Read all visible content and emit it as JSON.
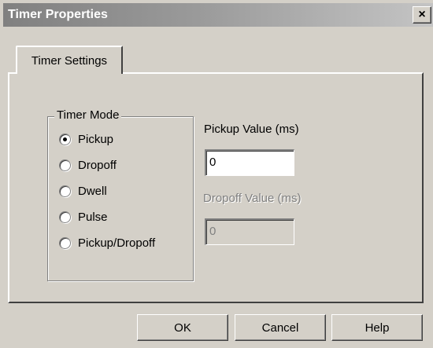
{
  "window": {
    "title": "Timer Properties",
    "close_label": "×"
  },
  "tabs": [
    {
      "label": "Timer Settings"
    }
  ],
  "timer_mode": {
    "title": "Timer Mode",
    "options": [
      {
        "label": "Pickup",
        "selected": true
      },
      {
        "label": "Dropoff",
        "selected": false
      },
      {
        "label": "Dwell",
        "selected": false
      },
      {
        "label": "Pulse",
        "selected": false
      },
      {
        "label": "Pickup/Dropoff",
        "selected": false
      }
    ]
  },
  "pickup": {
    "label": "Pickup Value (ms)",
    "value": "0",
    "enabled": true
  },
  "dropoff": {
    "label": "Dropoff Value (ms)",
    "value": "0",
    "enabled": false
  },
  "buttons": {
    "ok": "OK",
    "cancel": "Cancel",
    "help": "Help"
  }
}
